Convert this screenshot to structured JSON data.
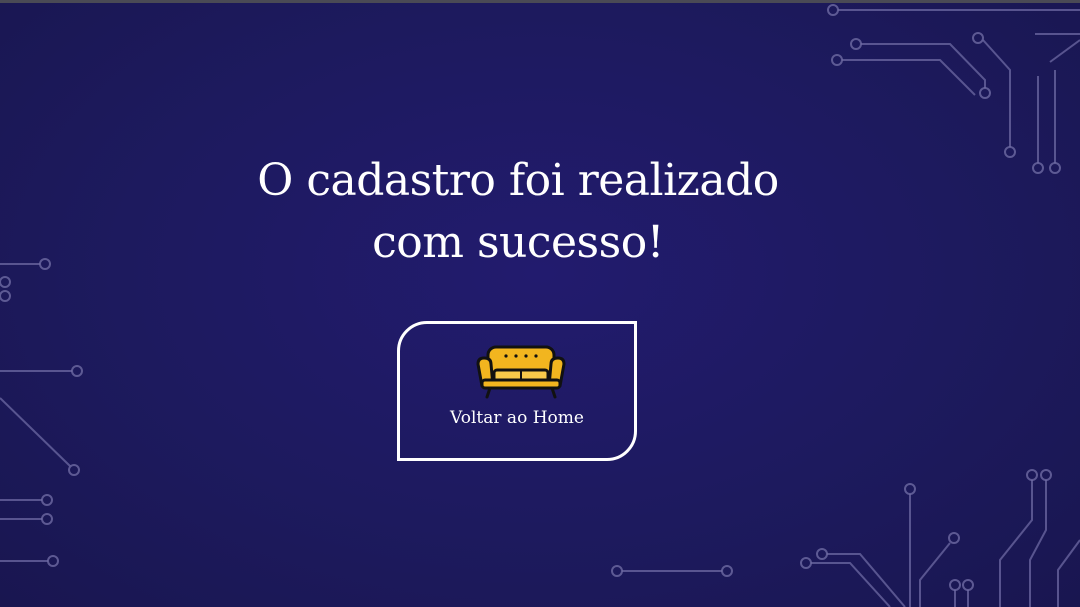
{
  "page": {
    "background_color": "#1d1a5e",
    "accent_color": "#f2b51f"
  },
  "message": {
    "line1": "O cadastro foi realizado",
    "line2": "com sucesso!"
  },
  "home_button": {
    "label": "Voltar ao Home",
    "icon": "sofa-icon"
  }
}
